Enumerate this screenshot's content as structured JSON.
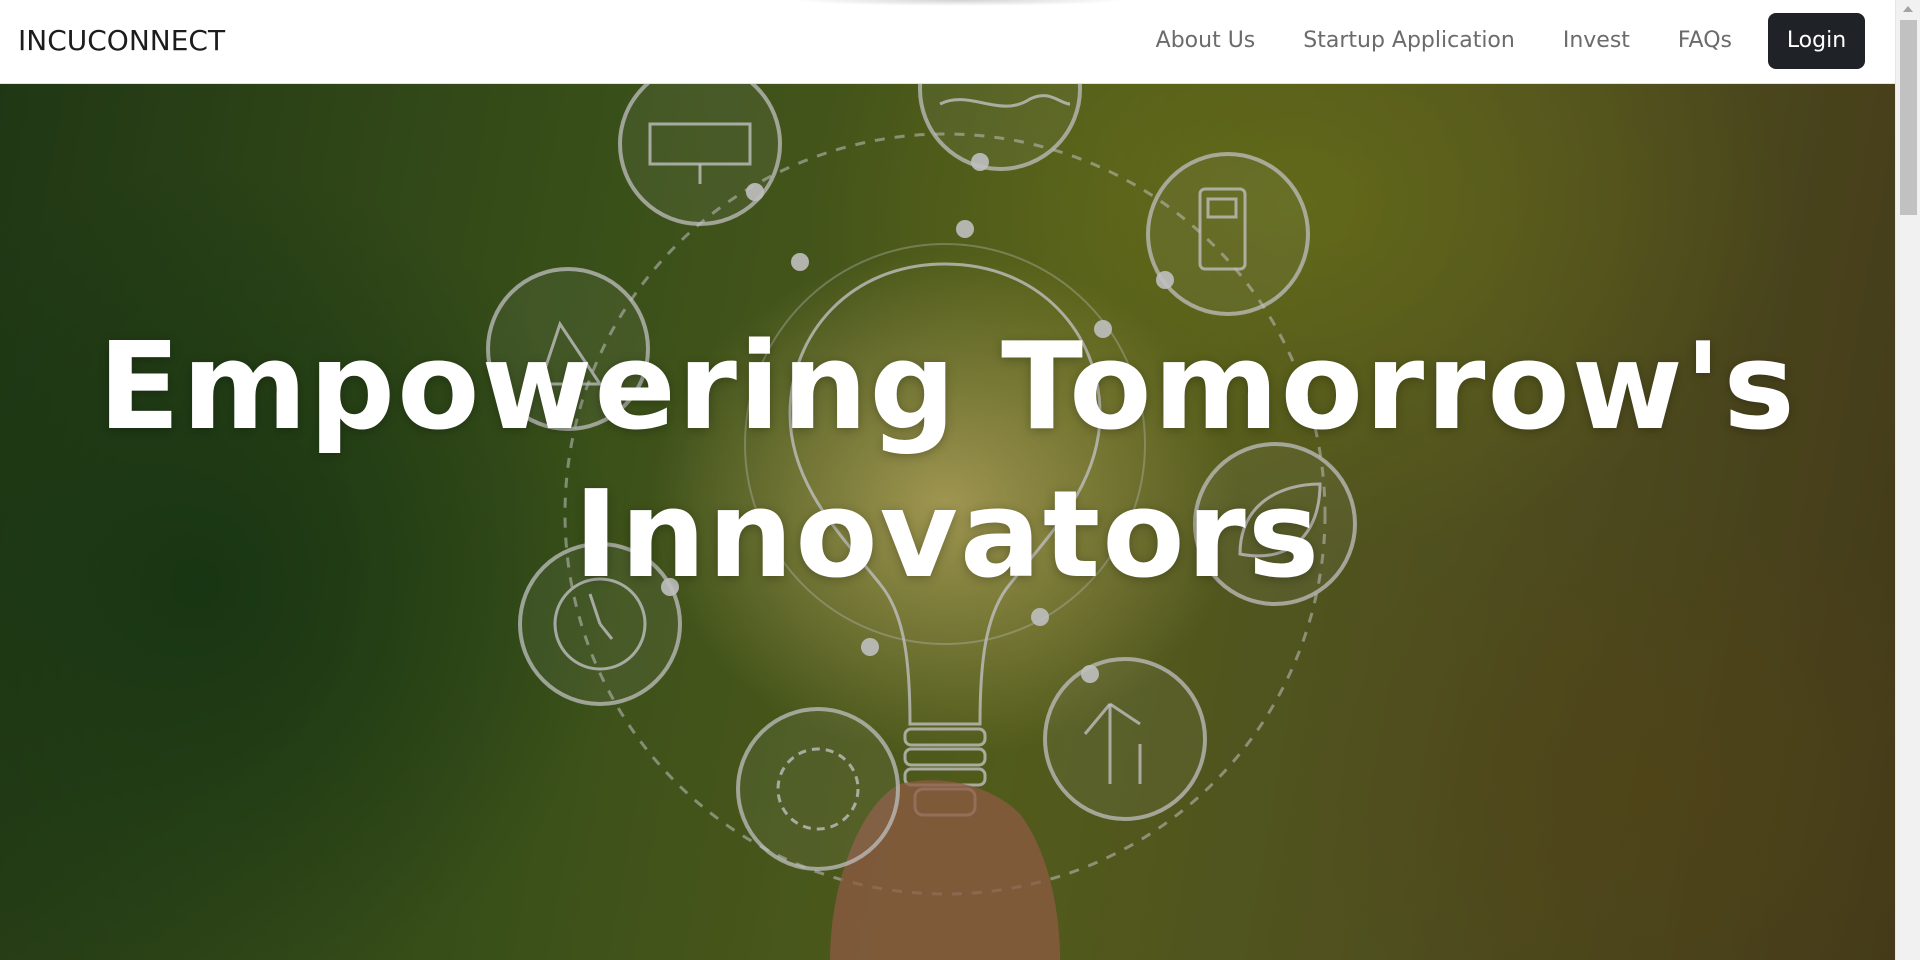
{
  "navbar": {
    "brand": "INCUCONNECT",
    "links": [
      {
        "label": "About Us"
      },
      {
        "label": "Startup Application"
      },
      {
        "label": "Invest"
      },
      {
        "label": "FAQs"
      }
    ],
    "login_label": "Login"
  },
  "hero": {
    "title_line1": "Empowering Tomorrow's",
    "title_line2": "Innovators",
    "background_icons": [
      "solar-panel-icon",
      "landscape-icon",
      "fuel-pump-icon",
      "oil-pump-icon",
      "leaf-icon",
      "clock-icon",
      "wind-turbine-icon",
      "recycle-icon",
      "light-bulb-icon"
    ]
  },
  "colors": {
    "navbar_bg": "#ffffff",
    "login_bg": "#1f2327",
    "nav_link": "#6b6b6b",
    "hero_text": "#ffffff"
  }
}
